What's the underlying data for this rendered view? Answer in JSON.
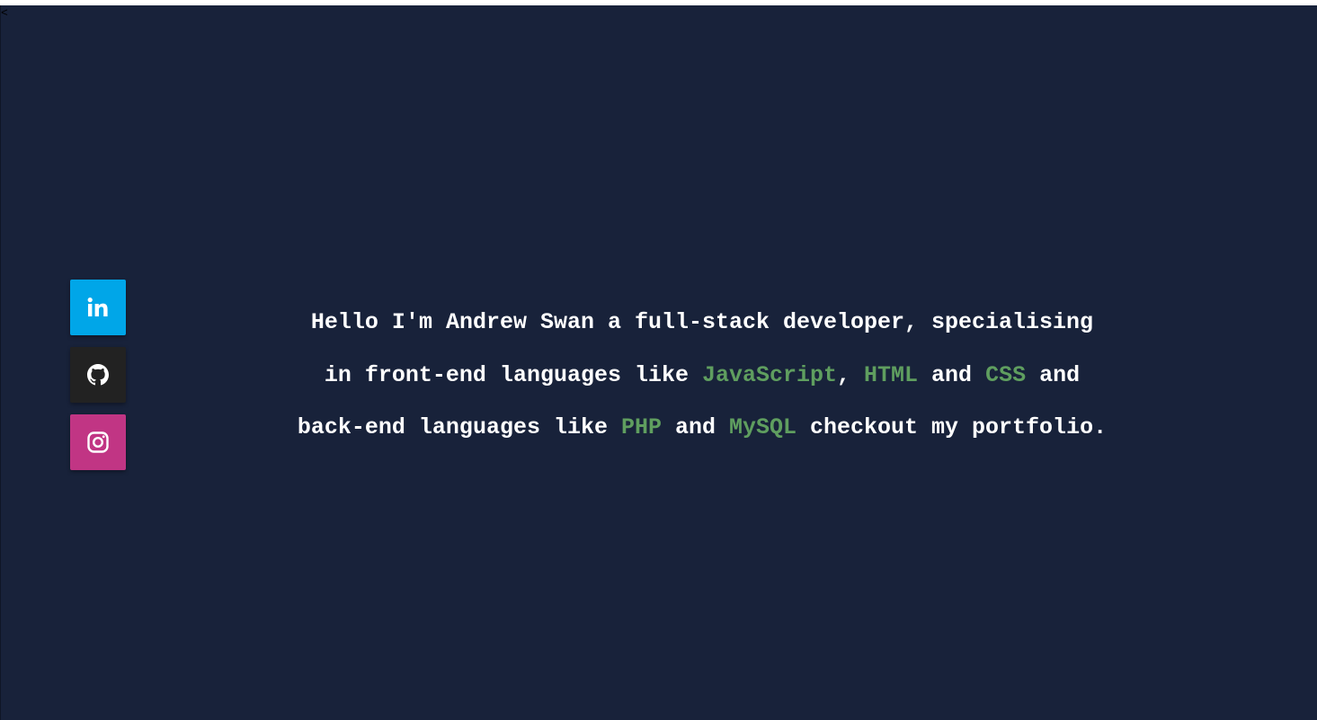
{
  "stray_text": "<",
  "colors": {
    "background": "#18223a",
    "text": "#ffffff",
    "highlight": "#5f9e5f",
    "linkedin": "#00a6e8",
    "github": "#222222",
    "instagram": "#c13584"
  },
  "social": [
    {
      "name": "linkedin",
      "icon": "linkedin-icon",
      "label": "in"
    },
    {
      "name": "github",
      "icon": "github-icon"
    },
    {
      "name": "instagram",
      "icon": "instagram-icon"
    }
  ],
  "intro": {
    "line1": "Hello I'm Andrew Swan a full-stack developer, specialising",
    "line2_pre": "in front-end languages like ",
    "lang_js": "JavaScript",
    "line2_comma": ", ",
    "lang_html": "HTML",
    "line2_and1": " and ",
    "lang_css": "CSS",
    "line2_and2": " and",
    "line3_pre": "back-end languages like ",
    "lang_php": "PHP",
    "line3_and": " and ",
    "lang_mysql": "MySQL",
    "line3_post": " checkout my portfolio."
  }
}
